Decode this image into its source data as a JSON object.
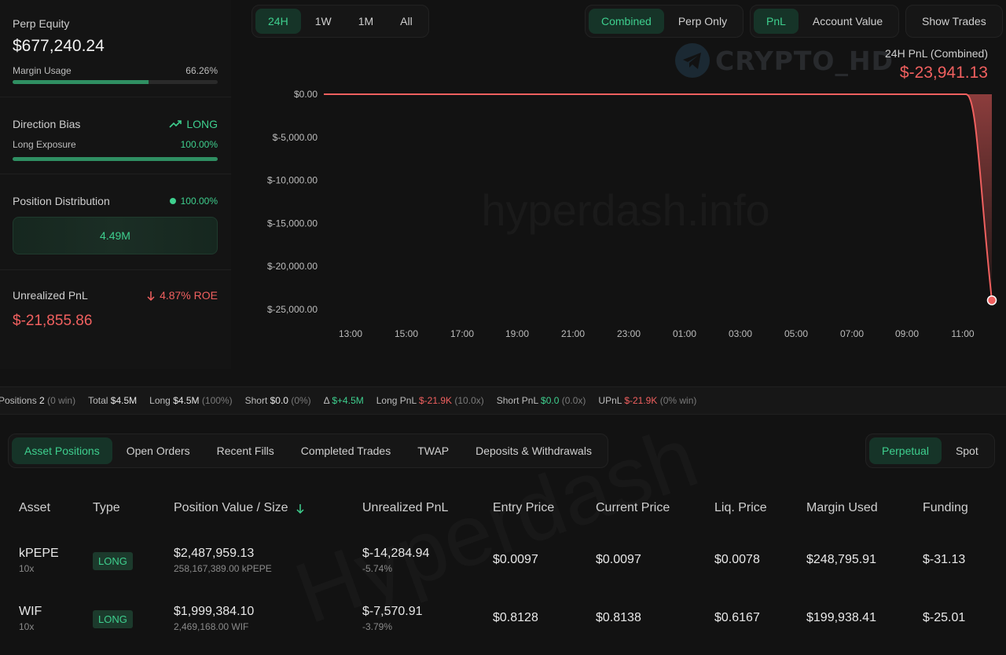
{
  "perp_equity": {
    "label": "Perp Equity",
    "value": "$677,240.24",
    "margin_label": "Margin Usage",
    "margin_value": "66.26%",
    "margin_fraction": 0.6626
  },
  "direction": {
    "label": "Direction Bias",
    "bias": "LONG",
    "exposure_label": "Long Exposure",
    "exposure_value": "100.00%",
    "exposure_fraction": 1.0
  },
  "distribution": {
    "label": "Position Distribution",
    "pct": "100.00%",
    "bar_value": "4.49M"
  },
  "upnl": {
    "label": "Unrealized PnL",
    "roe": "4.87% ROE",
    "value": "$-21,855.86"
  },
  "range_tabs": [
    "24H",
    "1W",
    "1M",
    "All"
  ],
  "range_active": 0,
  "mode_tabs": [
    "Combined",
    "Perp Only"
  ],
  "metric_tabs": [
    "PnL",
    "Account Value"
  ],
  "show_trades": "Show Trades",
  "watermark_logo": "CRYPTO_HD",
  "watermark_text": "hyperdash.info",
  "watermark_bg": "Hyperdash",
  "pnl_summary": {
    "label": "24H PnL (Combined)",
    "value": "$-23,941.13"
  },
  "colors": {
    "accent": "#3ecf8e",
    "negative": "#f0605f",
    "bg": "#121212"
  },
  "chart_data": {
    "type": "area",
    "x_ticks": [
      "13:00",
      "15:00",
      "17:00",
      "19:00",
      "21:00",
      "23:00",
      "01:00",
      "03:00",
      "05:00",
      "07:00",
      "09:00",
      "11:00"
    ],
    "y_ticks": [
      "$0.00",
      "$-5,000.00",
      "$-10,000.00",
      "$-15,000.00",
      "$-20,000.00",
      "$-25,000.00"
    ],
    "ylim": [
      -25000,
      0
    ],
    "series": [
      {
        "values": [
          0,
          0,
          0,
          0,
          0,
          0,
          0,
          0,
          0,
          0,
          0,
          0,
          0,
          -23941.13
        ]
      }
    ]
  },
  "strip": [
    {
      "k": "Positions",
      "v": "2",
      "p": "(0 win)"
    },
    {
      "k": "Total",
      "v": "$4.5M",
      "p": ""
    },
    {
      "k": "Long",
      "v": "$4.5M",
      "p": "(100%)"
    },
    {
      "k": "Short",
      "v": "$0.0",
      "p": "(0%)"
    },
    {
      "k": "Δ",
      "v": "$+4.5M",
      "p": ""
    },
    {
      "k": "Long PnL",
      "v": "$-21.9K",
      "p": "(10.0x)"
    },
    {
      "k": "Short PnL",
      "v": "$0.0",
      "p": "(0.0x)"
    },
    {
      "k": "UPnL",
      "v": "$-21.9K",
      "p": "(0% win)"
    }
  ],
  "tabs": [
    "Asset Positions",
    "Open Orders",
    "Recent Fills",
    "Completed Trades",
    "TWAP",
    "Deposits & Withdrawals"
  ],
  "market_tabs": [
    "Perpetual",
    "Spot"
  ],
  "table": {
    "headers": [
      "Asset",
      "Type",
      "Position Value / Size",
      "Unrealized PnL",
      "Entry Price",
      "Current Price",
      "Liq. Price",
      "Margin Used",
      "Funding"
    ],
    "rows": [
      {
        "asset": "kPEPE",
        "lev": "10x",
        "type": "LONG",
        "value": "$2,487,959.13",
        "size": "258,167,389.00 kPEPE",
        "upnl": "$-14,284.94",
        "upnl_pct": "-5.74%",
        "entry": "$0.0097",
        "current": "$0.0097",
        "liq": "$0.0078",
        "margin": "$248,795.91",
        "funding": "$-31.13"
      },
      {
        "asset": "WIF",
        "lev": "10x",
        "type": "LONG",
        "value": "$1,999,384.10",
        "size": "2,469,168.00 WIF",
        "upnl": "$-7,570.91",
        "upnl_pct": "-3.79%",
        "entry": "$0.8128",
        "current": "$0.8138",
        "liq": "$0.6167",
        "margin": "$199,938.41",
        "funding": "$-25.01"
      }
    ]
  }
}
